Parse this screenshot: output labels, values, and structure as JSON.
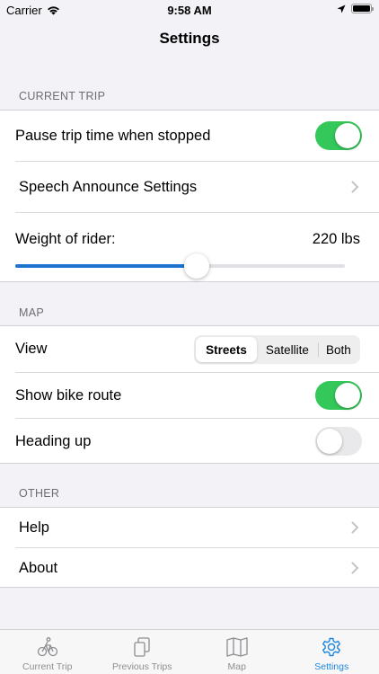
{
  "status_bar": {
    "carrier": "Carrier",
    "time": "9:58 AM"
  },
  "nav": {
    "title": "Settings"
  },
  "sections": {
    "current_trip": {
      "header": "CURRENT TRIP",
      "pause_label": "Pause trip time when stopped",
      "pause_on": true,
      "speech_label": "Speech Announce Settings",
      "weight_label": "Weight of rider:",
      "weight_value": "220  lbs",
      "weight_slider_fraction": 0.55
    },
    "map": {
      "header": "MAP",
      "view_label": "View",
      "view_options": [
        "Streets",
        "Satellite",
        "Both"
      ],
      "view_selected": "Streets",
      "bike_route_label": "Show bike route",
      "bike_route_on": true,
      "heading_label": "Heading up",
      "heading_on": false
    },
    "other": {
      "header": "OTHER",
      "help_label": "Help",
      "about_label": "About"
    }
  },
  "tab_bar": {
    "tabs": [
      {
        "label": "Current Trip",
        "icon": "bicycle-rider-icon"
      },
      {
        "label": "Previous Trips",
        "icon": "stacked-pages-icon"
      },
      {
        "label": "Map",
        "icon": "map-icon"
      },
      {
        "label": "Settings",
        "icon": "gear-icon"
      }
    ],
    "active": "Settings"
  },
  "colors": {
    "toggle_on": "#34c759",
    "accent": "#1f86e0",
    "slider_fill": "#1f73d0",
    "background": "#f2f2f7"
  }
}
